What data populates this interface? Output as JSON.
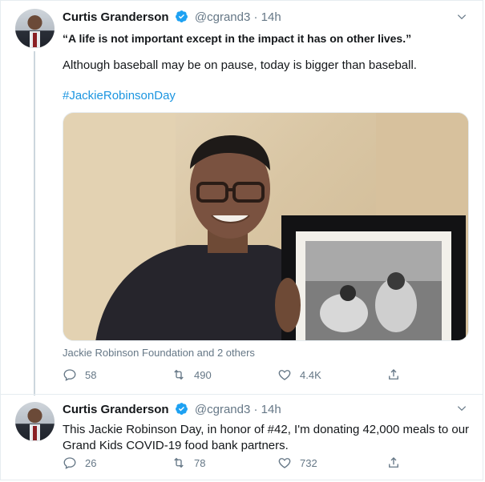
{
  "tweets": [
    {
      "author_name": "Curtis Granderson",
      "handle": "@cgrand3",
      "separator": "·",
      "time": "14h",
      "quote": "“A life is not important except in the impact it has on other lives.”",
      "line2": "Although baseball may be on pause, today is bigger than baseball.",
      "hashtag": "#JackieRobinsonDay",
      "media_caption": "Jackie Robinson Foundation and 2 others",
      "replies": "58",
      "retweets": "490",
      "likes": "4.4K"
    },
    {
      "author_name": "Curtis Granderson",
      "handle": "@cgrand3",
      "separator": "·",
      "time": "14h",
      "text": "This Jackie Robinson Day, in honor of #42, I'm donating 42,000 meals to our Grand Kids COVID-19 food bank partners.",
      "replies": "26",
      "retweets": "78",
      "likes": "732"
    }
  ],
  "colors": {
    "accent": "#1b95e0",
    "muted": "#657786",
    "verified": "#1da1f2"
  },
  "icons": [
    "verified-badge-icon",
    "chevron-down-icon",
    "reply-icon",
    "retweet-icon",
    "like-icon",
    "share-icon"
  ]
}
